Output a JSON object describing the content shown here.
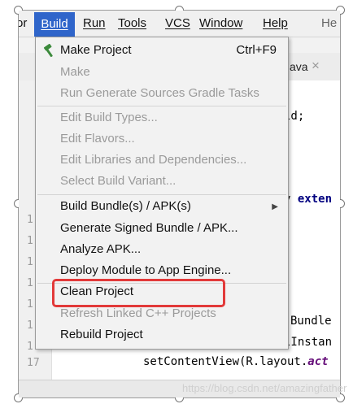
{
  "menubar": {
    "left_partial": "or",
    "items": [
      "Build",
      "Run",
      "Tools",
      "VCS",
      "Window",
      "Help"
    ],
    "right_partial": "He"
  },
  "tab": {
    "label_partial": "ava",
    "close_glyph": "×"
  },
  "code_lines": [
    {
      "text": "ld;"
    },
    {
      "plain": "y ",
      "keyword": "exten"
    },
    {
      "text": "Bundle"
    },
    {
      "text": "lInstan"
    },
    {
      "prefix": "setContentView(R.layout.",
      "italic": "act"
    }
  ],
  "line_numbers": [
    "1",
    "1",
    "1",
    "1",
    "1",
    "1",
    "1",
    "17"
  ],
  "build_menu": {
    "items": [
      {
        "label": "Make Project",
        "shortcut": "Ctrl+F9",
        "enabled": true,
        "icon": "hammer-icon"
      },
      {
        "label": "Make",
        "enabled": false
      },
      {
        "label": "Run Generate Sources Gradle Tasks",
        "enabled": false
      },
      {
        "label": "Edit Build Types...",
        "enabled": false
      },
      {
        "label": "Edit Flavors...",
        "enabled": false
      },
      {
        "label": "Edit Libraries and Dependencies...",
        "enabled": false
      },
      {
        "label": "Select Build Variant...",
        "enabled": false
      },
      {
        "label": "Build Bundle(s) / APK(s)",
        "enabled": true,
        "submenu_arrow": "▶"
      },
      {
        "label": "Generate Signed Bundle / APK...",
        "enabled": true
      },
      {
        "label": "Analyze APK...",
        "enabled": true
      },
      {
        "label": "Deploy Module to App Engine...",
        "enabled": true
      },
      {
        "label": "Clean Project",
        "enabled": true
      },
      {
        "label": "Refresh Linked C++ Projects",
        "enabled": false
      },
      {
        "label": "Rebuild Project",
        "enabled": true
      }
    ]
  },
  "watermark": "https://blog.csdn.net/amazingfather",
  "colors": {
    "menu_highlight": "#2f65ca",
    "annotation_box": "#e23a3a",
    "hammer": "#3c8a3c"
  }
}
